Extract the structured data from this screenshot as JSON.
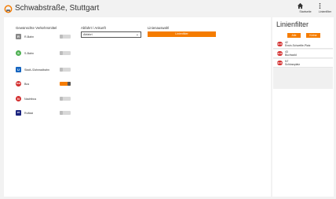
{
  "header": {
    "title": "Schwabstraße, Stuttgart",
    "home_label": "Startseite",
    "filter_label": "Linienfilter"
  },
  "main": {
    "verkehrsmittel_title": "Gewünschte Verkehrsmittel",
    "abfahrt_title": "Abfahrt / Ankunft",
    "linienauswahl_title": "Linienauswahl",
    "select_value": "Abfahrt",
    "linienfilter_button": "Linienfilter",
    "modes": [
      {
        "label": "R-Bahn",
        "icon": "R",
        "color": "#888888",
        "on": false
      },
      {
        "label": "S-Bahn",
        "icon": "S",
        "color": "#4caf50",
        "on": false
      },
      {
        "label": "Stadt-/Zahnradbahn",
        "icon": "U",
        "color": "#1565c0",
        "on": false
      },
      {
        "label": "Bus",
        "icon": "BUS",
        "color": "#d32f2f",
        "on": true
      },
      {
        "label": "Nachtbus",
        "icon": "N",
        "color": "#d32f2f",
        "on": false
      },
      {
        "label": "Ruftaxi",
        "icon": "RT",
        "color": "#1a237e",
        "on": false
      }
    ]
  },
  "side": {
    "title": "Linienfilter",
    "all_label": "Alle",
    "none_label": "Keine",
    "lines": [
      {
        "badge": "BUS",
        "number": "42",
        "destination": "Erwin-Schoettle-Platz"
      },
      {
        "badge": "BUS",
        "number": "43",
        "destination": "Buchwald"
      },
      {
        "badge": "BUS",
        "number": "N7",
        "destination": "Schlossplatz"
      }
    ]
  },
  "colors": {
    "accent": "#f57c00",
    "bus": "#d32f2f"
  }
}
